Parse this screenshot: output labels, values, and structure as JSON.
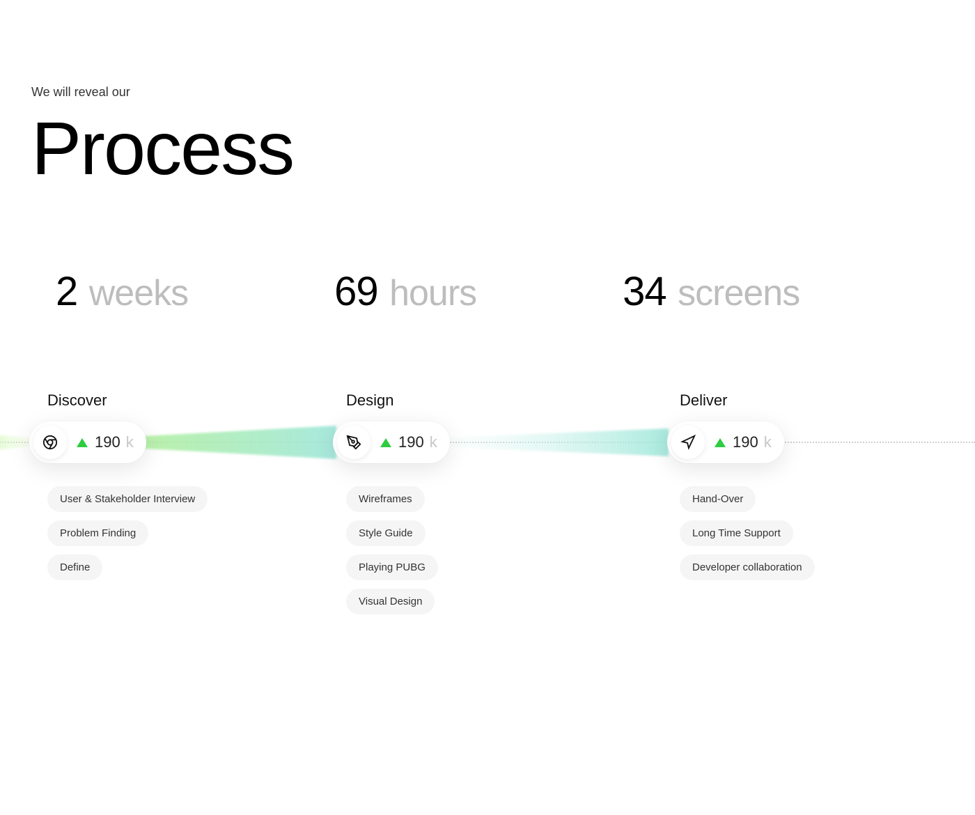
{
  "eyebrow": "We will reveal our",
  "title": "Process",
  "stats": [
    {
      "value": "2",
      "unit": "weeks"
    },
    {
      "value": "69",
      "unit": "hours"
    },
    {
      "value": "34",
      "unit": "screens"
    }
  ],
  "stages": [
    {
      "name": "Discover",
      "icon": "chrome-icon",
      "metric": {
        "value": "190",
        "suffix": "k"
      },
      "tags": [
        "User & Stakeholder Interview",
        "Problem Finding",
        "Define"
      ]
    },
    {
      "name": "Design",
      "icon": "pen-tool-icon",
      "metric": {
        "value": "190",
        "suffix": "k"
      },
      "tags": [
        "Wireframes",
        "Style Guide",
        "Playing PUBG",
        "Visual Design"
      ]
    },
    {
      "name": "Deliver",
      "icon": "navigation-icon",
      "metric": {
        "value": "190",
        "suffix": "k"
      },
      "tags": [
        "Hand-Over",
        "Long Time Support",
        "Developer collaboration"
      ]
    }
  ],
  "colors": {
    "accent_green": "#2ecc40",
    "beam_teal": "#9ae6d8",
    "beam_green": "#b6f28a"
  }
}
